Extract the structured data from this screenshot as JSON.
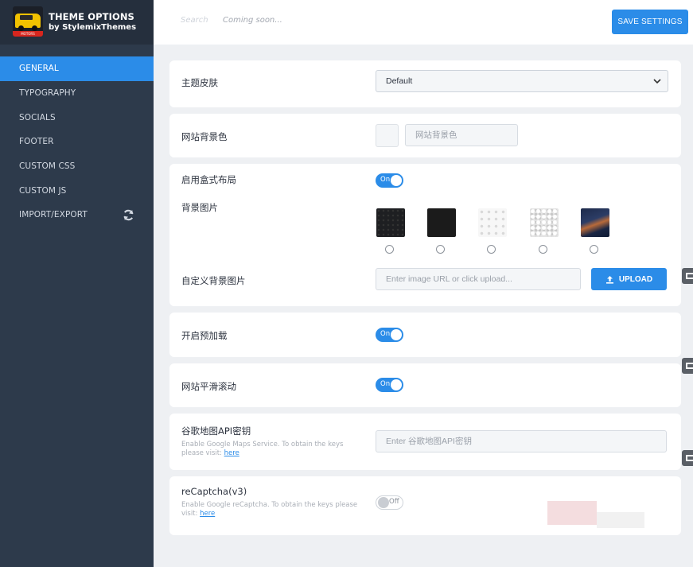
{
  "brand": {
    "title": "THEME OPTIONS",
    "subtitle": "by StylemixThemes",
    "logo_strip": "MOTORS"
  },
  "sidebar": {
    "items": [
      {
        "label": "GENERAL",
        "active": true
      },
      {
        "label": "TYPOGRAPHY"
      },
      {
        "label": "SOCIALS"
      },
      {
        "label": "FOOTER"
      },
      {
        "label": "CUSTOM CSS"
      },
      {
        "label": "CUSTOM JS"
      },
      {
        "label": "IMPORT/EXPORT",
        "icon": "refresh-icon"
      }
    ]
  },
  "topbar": {
    "search_faint": "Search",
    "status": "Coming soon...",
    "save_label": "SAVE SETTINGS"
  },
  "settings": {
    "skin": {
      "label": "主题皮肤",
      "value": "Default"
    },
    "bg_color": {
      "label": "网站背景色",
      "placeholder": "网站背景色"
    },
    "boxed": {
      "label": "启用盒式布局",
      "toggle": "On"
    },
    "bg_image": {
      "label": "背景图片",
      "options_count": 5
    },
    "custom_bg": {
      "label": "自定义背景图片",
      "placeholder": "Enter image URL or click upload...",
      "button": "UPLOAD"
    },
    "preloader": {
      "label": "开启预加载",
      "toggle": "On"
    },
    "smooth_scroll": {
      "label": "网站平滑滚动",
      "toggle": "On"
    },
    "gmap": {
      "label": "谷歌地图API密钥",
      "help": "Enable Google Maps Service. To obtain the keys please visit:",
      "link": "here",
      "placeholder": "Enter 谷歌地图API密钥"
    },
    "recaptcha": {
      "label": "reCaptcha(v3)",
      "help": "Enable Google reCaptcha. To obtain the keys please visit:",
      "link": "here",
      "toggle": "Off"
    }
  },
  "colors": {
    "accent": "#2b8ce8",
    "sidebar": "#2d3a4b",
    "sidebar_header": "#252f3d"
  }
}
